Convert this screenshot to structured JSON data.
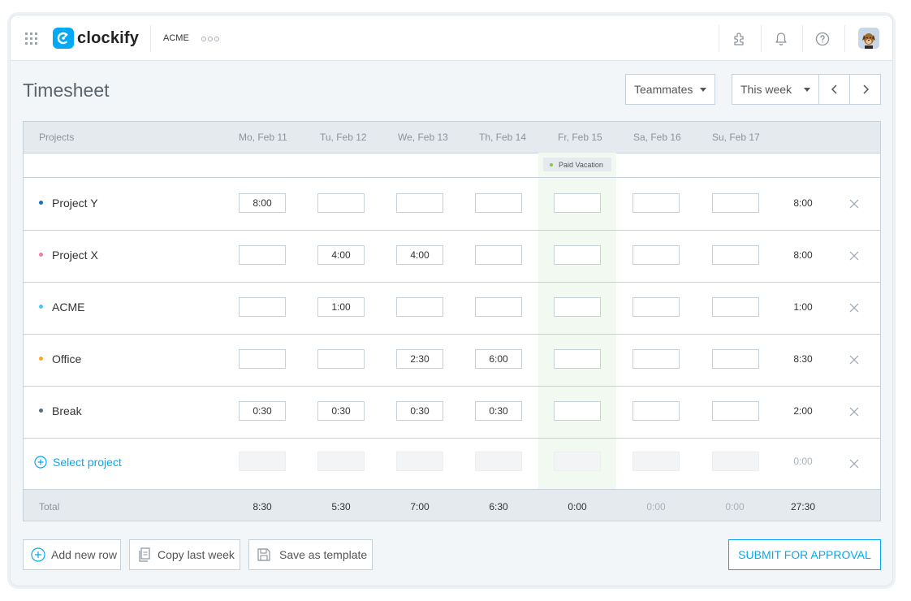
{
  "app": {
    "logo_text": "clockify",
    "workspace": "ACME",
    "accent_color": "#03a9f4"
  },
  "header": {
    "title": "Timesheet",
    "teammates_label": "Teammates",
    "week_label": "This week"
  },
  "table": {
    "projects_header": "Projects",
    "days": [
      "Mo, Feb 11",
      "Tu, Feb 12",
      "We, Feb 13",
      "Th, Feb 14",
      "Fr, Feb 15",
      "Sa, Feb 16",
      "Su, Feb 17"
    ],
    "vacation_badge": "Paid Vacation",
    "rows": [
      {
        "name": "Project Y",
        "color": "#1e6fb5",
        "values": [
          "8:00",
          "",
          "",
          "",
          "",
          "",
          ""
        ],
        "total": "8:00"
      },
      {
        "name": "Project X",
        "color": "#ef7f9a",
        "values": [
          "",
          "4:00",
          "4:00",
          "",
          "",
          "",
          ""
        ],
        "total": "8:00"
      },
      {
        "name": "ACME",
        "color": "#4fc3f7",
        "values": [
          "",
          "1:00",
          "",
          "",
          "",
          "",
          ""
        ],
        "total": "1:00"
      },
      {
        "name": "Office",
        "color": "#f9a825",
        "values": [
          "",
          "",
          "2:30",
          "6:00",
          "",
          "",
          ""
        ],
        "total": "8:30"
      },
      {
        "name": "Break",
        "color": "#546e7a",
        "values": [
          "0:30",
          "0:30",
          "0:30",
          "0:30",
          "",
          "",
          ""
        ],
        "total": "2:00"
      }
    ],
    "select_project_label": "Select project",
    "select_project_total": "0:00",
    "total_label": "Total",
    "totals": [
      "8:30",
      "5:30",
      "7:00",
      "6:30",
      "0:00",
      "0:00",
      "0:00"
    ],
    "grand_total": "27:30"
  },
  "footer": {
    "add_row_label": "Add new row",
    "copy_week_label": "Copy last week",
    "save_template_label": "Save as template",
    "submit_label": "SUBMIT FOR APPROVAL"
  },
  "icons": [
    "apps-grid-icon",
    "clockify-logo-icon",
    "more-dots-icon",
    "extension-icon",
    "bell-icon",
    "help-icon",
    "avatar",
    "chevron-left-icon",
    "chevron-right-icon",
    "close-icon",
    "plus-circle-icon",
    "copy-icon",
    "save-icon"
  ]
}
